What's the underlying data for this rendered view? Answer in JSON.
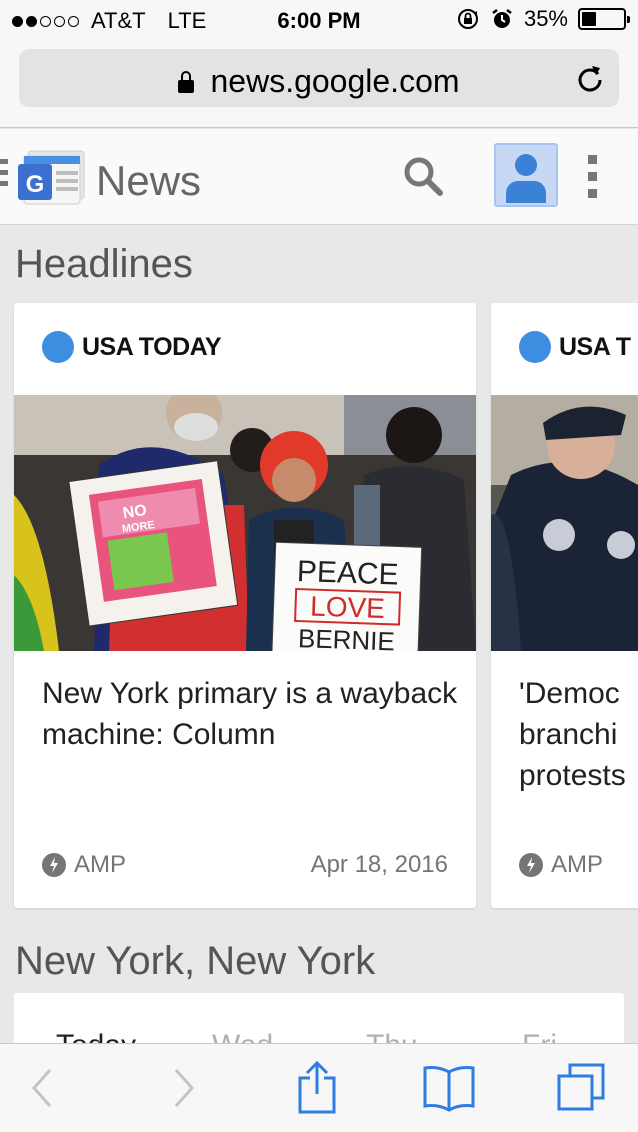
{
  "status_bar": {
    "carrier": "AT&T",
    "network": "LTE",
    "time": "6:00 PM",
    "battery": "35%",
    "battery_level": 0.35,
    "signal_bars": 2
  },
  "browser": {
    "url": "news.google.com"
  },
  "app": {
    "title": "News"
  },
  "headlines": {
    "section_title": "Headlines",
    "cards": [
      {
        "publisher": "USA TODAY",
        "headline": "New York primary is a wayback machine: Column",
        "amp_label": "AMP",
        "date": "Apr 18, 2016"
      },
      {
        "publisher": "USA T",
        "headline": "'Democ branchi protests",
        "amp_label": "AMP"
      }
    ]
  },
  "weather": {
    "section_title": "New York, New York",
    "days": [
      "Today",
      "Wed",
      "Thu",
      "Fri"
    ]
  },
  "colors": {
    "publisher_dot": "#3d8ee0",
    "avatar": "#3b82d6",
    "link_blue": "#2f7de1"
  }
}
